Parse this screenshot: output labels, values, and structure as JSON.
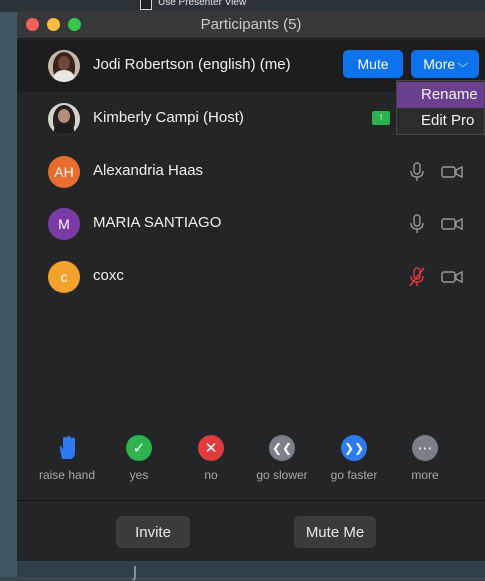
{
  "background": {
    "top_menu_text": "Use Presenter View"
  },
  "window": {
    "title": "Participants (5)"
  },
  "me": {
    "name": "Jodi Robertson (english)  (me)",
    "mute_label": "Mute",
    "more_label": "More"
  },
  "more_menu": {
    "items": [
      "Rename",
      "Edit Pro"
    ]
  },
  "participants": [
    {
      "name": "Kimberly Campi (Host)",
      "avatar": "photo",
      "sharing": true
    },
    {
      "name": "Alexandria Haas",
      "initials": "AH",
      "mic": "on",
      "video": "off"
    },
    {
      "name": "MARIA SANTIAGO",
      "initials": "M",
      "mic": "on",
      "video": "off"
    },
    {
      "name": "coxc",
      "initials": "c",
      "mic": "muted",
      "video": "off"
    }
  ],
  "reactions": [
    {
      "label": "raise hand",
      "icon": "raise-hand-icon"
    },
    {
      "label": "yes",
      "icon": "check-icon"
    },
    {
      "label": "no",
      "icon": "x-icon"
    },
    {
      "label": "go slower",
      "icon": "rewind-icon"
    },
    {
      "label": "go faster",
      "icon": "fast-forward-icon"
    },
    {
      "label": "more",
      "icon": "ellipsis-icon"
    }
  ],
  "footer": {
    "invite_label": "Invite",
    "mute_me_label": "Mute Me"
  },
  "colors": {
    "accent": "#0e72ed",
    "menu_highlight": "#6b3f8f",
    "share_badge": "#2bb24c",
    "muted_mic": "#e0393e"
  }
}
